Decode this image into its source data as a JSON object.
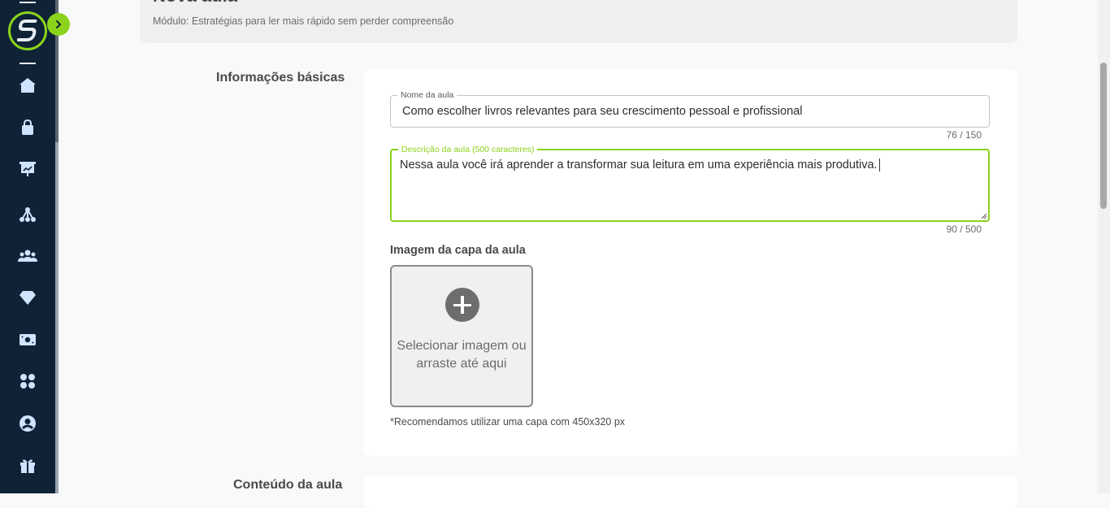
{
  "header": {
    "title": "Nova aula",
    "subtitle": "Módulo: Estratégias para ler mais rápido sem perder compreensão"
  },
  "sidebar": {
    "logo_icon": "s-logo-icon",
    "expand_icon": "chevron-right-icon",
    "items": [
      {
        "icon": "home-icon"
      },
      {
        "icon": "shopping-bag-icon"
      },
      {
        "icon": "presentation-chart-icon"
      },
      {
        "icon": "network-icon"
      },
      {
        "icon": "users-icon"
      },
      {
        "icon": "diamond-icon"
      },
      {
        "icon": "money-icon"
      },
      {
        "icon": "apps-grid-icon"
      },
      {
        "icon": "user-circle-icon"
      },
      {
        "icon": "gift-icon"
      }
    ],
    "accent_color": "#8bd31b",
    "background_color": "#0f2236"
  },
  "basic_info": {
    "section_title": "Informações básicas",
    "name_field": {
      "label": "Nome da aula",
      "value": "Como escolher livros relevantes para seu crescimento pessoal e profissional",
      "counter": "76 / 150"
    },
    "description_field": {
      "label": "Descrição da aula (500 caracteres)",
      "value": "Nessa aula você irá aprender a transformar sua leitura em uma experiência mais produtiva.",
      "counter": "90 / 500"
    },
    "cover_image": {
      "title": "Imagem da capa da aula",
      "button_text": "Selecionar imagem ou arraste até aqui",
      "hint": "*Recomendamos utilizar uma capa com 450x320 px"
    }
  },
  "content_section": {
    "section_title": "Conteúdo da aula"
  }
}
